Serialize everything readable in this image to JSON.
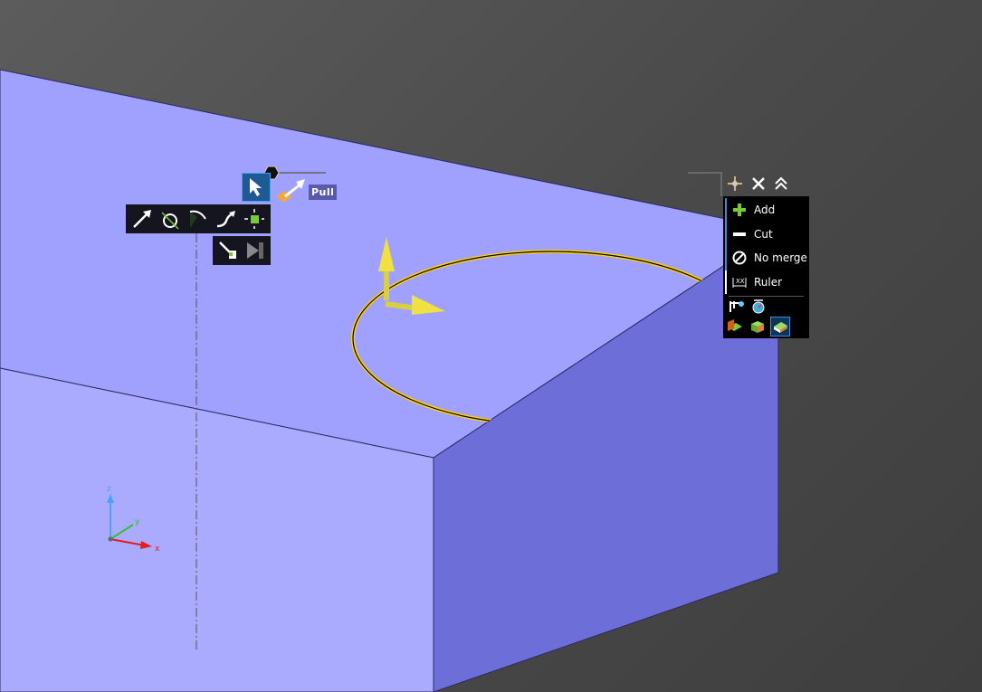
{
  "mini_toolbar": {
    "pull_label": "Pull",
    "tools": [
      "pull-arrow-icon",
      "revolve-icon",
      "sweep-icon",
      "blend-icon",
      "explode-icon"
    ],
    "tools2": [
      "pivot-icon",
      "complete-icon"
    ]
  },
  "options_panel": {
    "items": [
      {
        "label": "Add",
        "icon": "plus-icon"
      },
      {
        "label": "Cut",
        "icon": "minus-icon"
      },
      {
        "label": "No merge",
        "icon": "no-merge-icon"
      },
      {
        "label": "Ruler",
        "icon": "ruler-icon"
      }
    ]
  },
  "triad": {
    "x": "x",
    "y": "y",
    "z": "z"
  },
  "colors": {
    "top_face": "#a0a0ff",
    "front_face": "#aaaaff",
    "side_face": "#6e6ed8",
    "edge_highlight": "#ffd700"
  }
}
